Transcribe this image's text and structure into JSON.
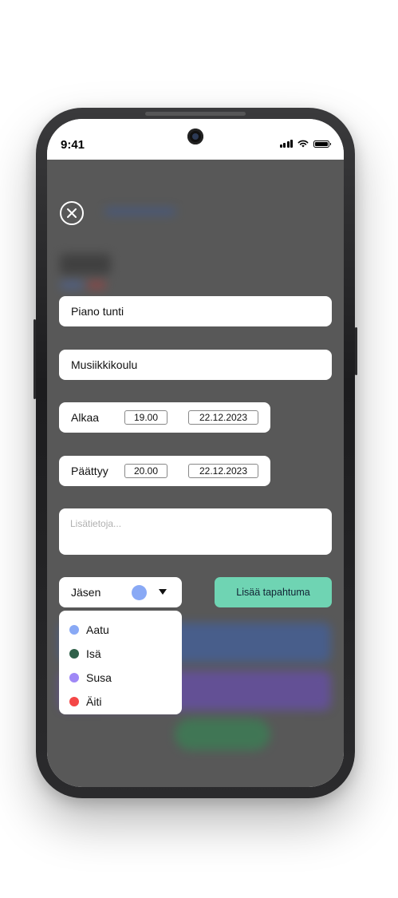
{
  "status_bar": {
    "time": "9:41"
  },
  "form": {
    "title_value": "Piano tunti",
    "location_value": "Musiikkikoulu",
    "start": {
      "label": "Alkaa",
      "time": "19.00",
      "date": "22.12.2023"
    },
    "end": {
      "label": "Päättyy",
      "time": "20.00",
      "date": "22.12.2023"
    },
    "notes_placeholder": "Lisätietoja...",
    "member": {
      "label": "Jäsen",
      "selected_color": "#89a9f5"
    },
    "add_button": "Lisää tapahtuma"
  },
  "member_options": [
    {
      "name": "Aatu",
      "color": "#89a9f5"
    },
    {
      "name": "Isä",
      "color": "#2f6049"
    },
    {
      "name": "Susa",
      "color": "#9f88f6"
    },
    {
      "name": "Äiti",
      "color": "#f44747"
    }
  ],
  "colors": {
    "accent": "#6fd4b3",
    "overlay": "#585858"
  }
}
